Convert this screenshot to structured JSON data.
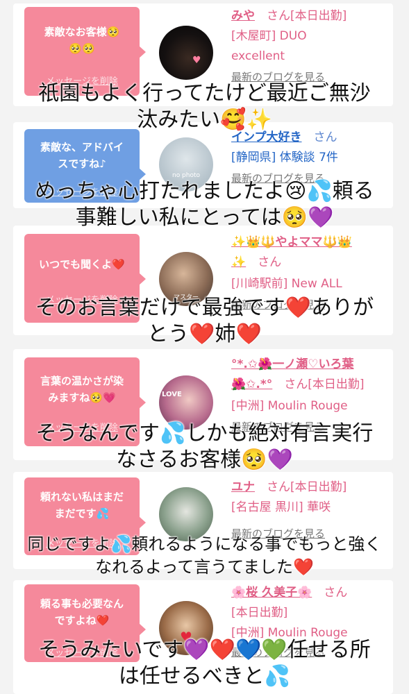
{
  "delete_label": "メッセージを削除",
  "blog_label": "最新のブログを見る",
  "san": "さん",
  "cards": [
    {
      "bubble_lines": [
        "素敵なお客様🥺",
        "🥺🥺"
      ],
      "bubble_color": "pink",
      "name": "みや",
      "tag": "[本日出勤]",
      "info_lines": [
        "[木屋町] DUO",
        "excellent"
      ],
      "overlay_lines": [
        "祇園もよく行ってたけど最近ご無沙",
        "汰みたい🥰✨"
      ]
    },
    {
      "bubble_lines": [
        "素敵な、アドバイ",
        "スですね♪"
      ],
      "bubble_color": "blue",
      "name": "インプ大好き",
      "tag": "",
      "info_lines": [
        "[静岡県] 体験談 7件"
      ],
      "overlay_lines": [
        "めっちゃ心打たれましたよ😢💦頼る",
        "事難しい私にとっては🥺💜"
      ]
    },
    {
      "bubble_lines": [
        "いつでも聞くよ❤️"
      ],
      "bubble_color": "pink",
      "name": "✨👑🔱やよママ🔱👑",
      "name2": "✨",
      "tag": "",
      "info_lines": [
        "[川崎駅前] New ALL"
      ],
      "overlay_lines": [
        "そのお言葉だけで最強です❤️ありが",
        "とう❤️姉❤️"
      ]
    },
    {
      "bubble_lines": [
        "言葉の温かさが染",
        "みますね🥺💗"
      ],
      "bubble_color": "pink",
      "name": "°*.✩🌺一ノ瀬♡いろ葉",
      "name2": "🌺✩.*°",
      "tag": "[本日出勤]",
      "info_lines": [
        "[中洲] Moulin Rouge"
      ],
      "overlay_lines": [
        "そうなんです💦しかも絶対有言実行",
        "なさるお客様🥺💜"
      ]
    },
    {
      "bubble_lines": [
        "頼れない私はまだ",
        "まだです💦"
      ],
      "bubble_color": "pink",
      "name": "ユナ",
      "tag": "[本日出勤]",
      "info_lines": [
        "[名古屋 黒川] 華咲"
      ],
      "overlay_lines": [
        "同じですよ💦頼れるようになる事でもっと強く",
        "なれるよって言うてました❤️"
      ]
    },
    {
      "bubble_lines": [
        "頼る事も必要なん",
        "ですよね❤️"
      ],
      "bubble_color": "pink",
      "name": "🌸桜 久美子🌸",
      "tag": "",
      "info_lines": [
        "[本日出勤]",
        "[中洲] Moulin Rouge"
      ],
      "overlay_lines": [
        "そうみたいです💜❤️💙💚任せる所",
        "は任せるべきと💦"
      ]
    }
  ],
  "colors": {
    "pink_bubble": "#f5899b",
    "blue_bubble": "#6f9fe3",
    "name_pink": "#e05f86",
    "name_blue": "#2466c6"
  },
  "avatar_note_text": "no photo",
  "avatar3_badge": "マスター",
  "avatar4_badge": "LOVE"
}
